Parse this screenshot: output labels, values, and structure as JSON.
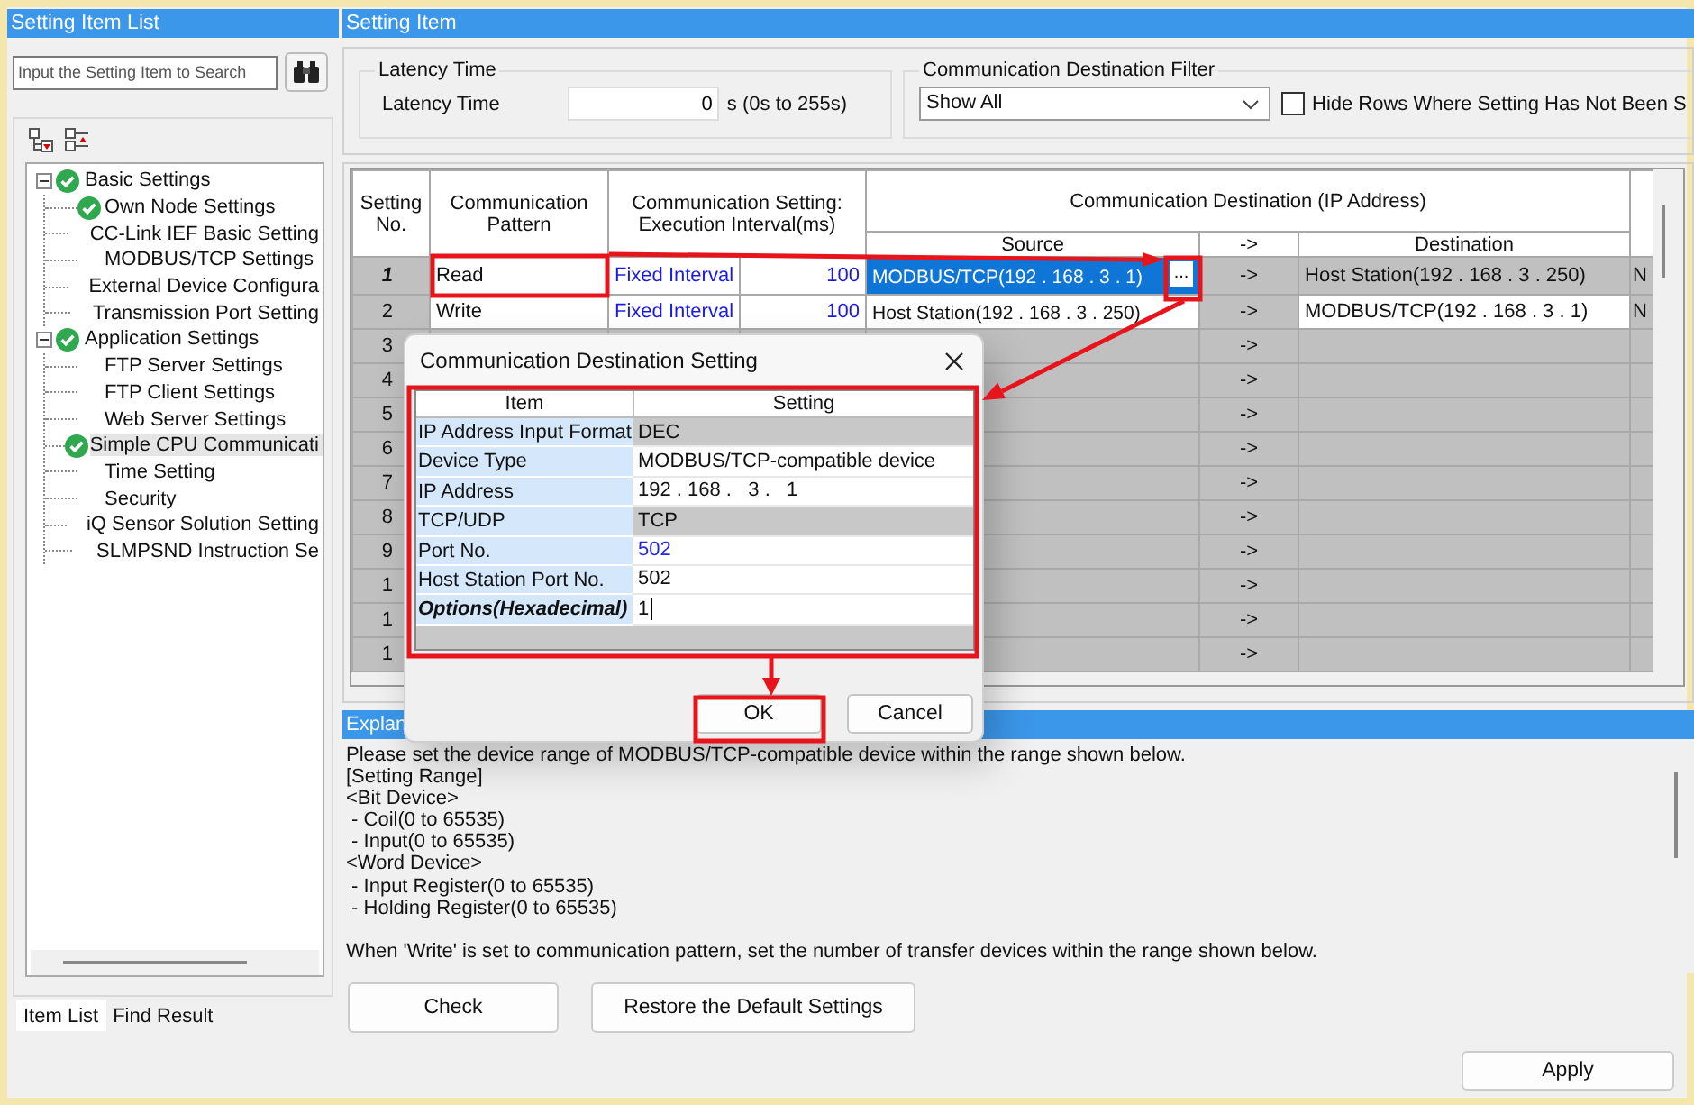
{
  "setting_item_list": {
    "title": "Setting Item List",
    "search": {
      "placeholder": "Input the Setting Item to Search"
    },
    "tree": [
      {
        "label": "Basic Settings",
        "checked": true,
        "expanded": true,
        "selected": false,
        "children": [
          {
            "label": "Own Node Settings",
            "checked": true,
            "selected": false
          },
          {
            "label": "CC-Link IEF Basic Setting",
            "checked": false,
            "selected": false
          },
          {
            "label": "MODBUS/TCP Settings",
            "checked": false,
            "selected": false
          },
          {
            "label": "External Device Configura",
            "checked": false,
            "selected": false
          },
          {
            "label": "Transmission Port Setting",
            "checked": false,
            "selected": false
          }
        ]
      },
      {
        "label": "Application Settings",
        "checked": true,
        "expanded": true,
        "selected": false,
        "children": [
          {
            "label": "FTP Server Settings",
            "checked": false,
            "selected": false
          },
          {
            "label": "FTP Client Settings",
            "checked": false,
            "selected": false
          },
          {
            "label": "Web Server Settings",
            "checked": false,
            "selected": false
          },
          {
            "label": "Simple CPU Communicati",
            "checked": true,
            "selected": true
          },
          {
            "label": "Time Setting",
            "checked": false,
            "selected": false
          },
          {
            "label": "Security",
            "checked": false,
            "selected": false
          },
          {
            "label": "iQ Sensor Solution Setting",
            "checked": false,
            "selected": false
          },
          {
            "label": "SLMPSND Instruction Se",
            "checked": false,
            "selected": false
          }
        ]
      }
    ],
    "tabs": [
      {
        "label": "Item List",
        "selected": true
      },
      {
        "label": "Find Result",
        "selected": false
      }
    ]
  },
  "setting_item": {
    "title": "Setting Item",
    "latency": {
      "group": "Latency Time",
      "label": "Latency Time",
      "value": "0",
      "range": "s (0s to 255s)"
    },
    "filter": {
      "group": "Communication Destination Filter",
      "value": "Show All",
      "hide_rows": {
        "label": "Hide Rows Where Setting Has Not Been S",
        "checked": false
      }
    },
    "table": {
      "headers": {
        "no": "Setting No.",
        "pattern": "Communication Pattern",
        "interval": "Communication Setting: Execution Interval(ms)",
        "destination_group": "Communication Destination (IP Address)",
        "source": "Source",
        "arrow": "->",
        "destination": "Destination"
      },
      "rows": [
        {
          "no": "1",
          "selected": true,
          "pattern": "Read",
          "interval_type": "Fixed Interval",
          "interval": "100",
          "source": "MODBUS/TCP(192 . 168 .   3 .   1)",
          "button": "...",
          "arrow": "->",
          "destination": "Host Station(192 . 168 .   3 . 250)",
          "destination_editable": false,
          "column_8": "N"
        },
        {
          "no": "2",
          "selected": false,
          "pattern": "Write",
          "interval_type": "Fixed Interval",
          "interval": "100",
          "source": "Host Station(192 . 168 .   3 . 250)",
          "arrow": "->",
          "destination": "MODBUS/TCP(192 . 168 .   3 .   1)",
          "destination_editable": true,
          "column_8": "N"
        },
        {
          "no": "3",
          "selected": false,
          "arrow": "->"
        },
        {
          "no": "4",
          "selected": false,
          "arrow": "->"
        },
        {
          "no": "5",
          "selected": false,
          "arrow": "->"
        },
        {
          "no": "6",
          "selected": false,
          "arrow": "->"
        },
        {
          "no": "7",
          "selected": false,
          "arrow": "->"
        },
        {
          "no": "8",
          "selected": false,
          "arrow": "->"
        },
        {
          "no": "9",
          "selected": false,
          "arrow": "->"
        },
        {
          "no": "1",
          "selected": false,
          "arrow": "->"
        },
        {
          "no": "1",
          "selected": false,
          "arrow": "->"
        },
        {
          "no": "1",
          "selected": false,
          "arrow": "->"
        }
      ]
    },
    "explanation": {
      "title": "Explan",
      "blocks": [
        [
          "Please set the device range of MODBUS/TCP-compatible device within the range shown below.",
          "[Setting Range]",
          "<Bit Device>",
          " - Coil(0 to 65535)",
          " - Input(0 to 65535)",
          "<Word Device>",
          " - Input Register(0 to 65535)",
          " - Holding Register(0 to 65535)"
        ],
        [
          "When 'Write' is set to communication pattern, set the number of transfer devices within the range shown below."
        ]
      ]
    },
    "buttons": [
      "Check",
      "Restore the Default Settings"
    ]
  },
  "apply_button": "Apply",
  "dialog": {
    "title": "Communication Destination Setting",
    "columns": [
      "Item",
      "Setting"
    ],
    "rows": [
      {
        "item": "IP Address Input Format",
        "setting": "DEC",
        "readonly": true,
        "bold": false,
        "modified": false,
        "editing": false
      },
      {
        "item": "Device Type",
        "setting": "MODBUS/TCP-compatible device",
        "readonly": false,
        "bold": false,
        "modified": false,
        "editing": false
      },
      {
        "item": "IP Address",
        "setting": "192 . 168 .   3 .   1",
        "readonly": false,
        "bold": false,
        "modified": false,
        "editing": false
      },
      {
        "item": "TCP/UDP",
        "setting": "TCP",
        "readonly": true,
        "bold": false,
        "modified": false,
        "editing": false
      },
      {
        "item": "Port No.",
        "setting": "502",
        "readonly": false,
        "bold": false,
        "modified": true,
        "editing": false
      },
      {
        "item": "Host Station Port No.",
        "setting": "502",
        "readonly": false,
        "bold": false,
        "modified": false,
        "editing": false
      },
      {
        "item": "Options(Hexadecimal)",
        "setting": "1",
        "readonly": false,
        "bold": true,
        "modified": false,
        "editing": true
      }
    ],
    "buttons": [
      "OK",
      "Cancel"
    ]
  }
}
